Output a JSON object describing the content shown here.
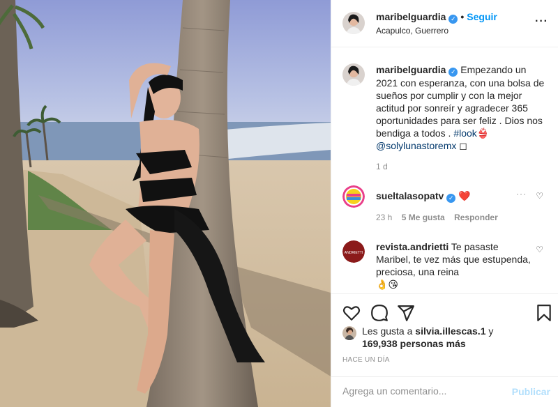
{
  "post": {
    "username": "maribelguardia",
    "follow_label": "Seguir",
    "location": "Acapulco, Guerrero",
    "more_icon": "more-options-icon"
  },
  "caption": {
    "username": "maribelguardia",
    "text": "Empezando un 2021 con esperanza, con una bolsa de sueños por cumplir y con la mejor actitud por sonreír y agradecer 365 oportunidades para ser feliz . Dios nos bendiga a todos . ",
    "hashtag": "#look",
    "emoji": "👙",
    "mention": "@solylunastoremx",
    "trailing": " ◻",
    "age": "1 d"
  },
  "comments": [
    {
      "username": "sueltalasopatv",
      "text": "❤️",
      "age": "23 h",
      "likes": "5 Me gusta",
      "reply": "Responder"
    },
    {
      "username": "revista.andrietti",
      "text": "Te pasaste Maribel, te vez más que estupenda, preciosa, una reina",
      "emojis": "👌😘"
    }
  ],
  "likes": {
    "prefix": "Les gusta a",
    "user": "silvia.illescas.1",
    "join": "y",
    "count": "169,938 personas más"
  },
  "timestamp": "HACE UN DÍA",
  "add_comment": {
    "placeholder": "Agrega un comentario...",
    "publish_label": "Publicar"
  },
  "colors": {
    "accent": "#0095f6",
    "verified": "#3897f0",
    "publish_disabled": "#b2dffc",
    "muted": "#8e8e8e"
  }
}
